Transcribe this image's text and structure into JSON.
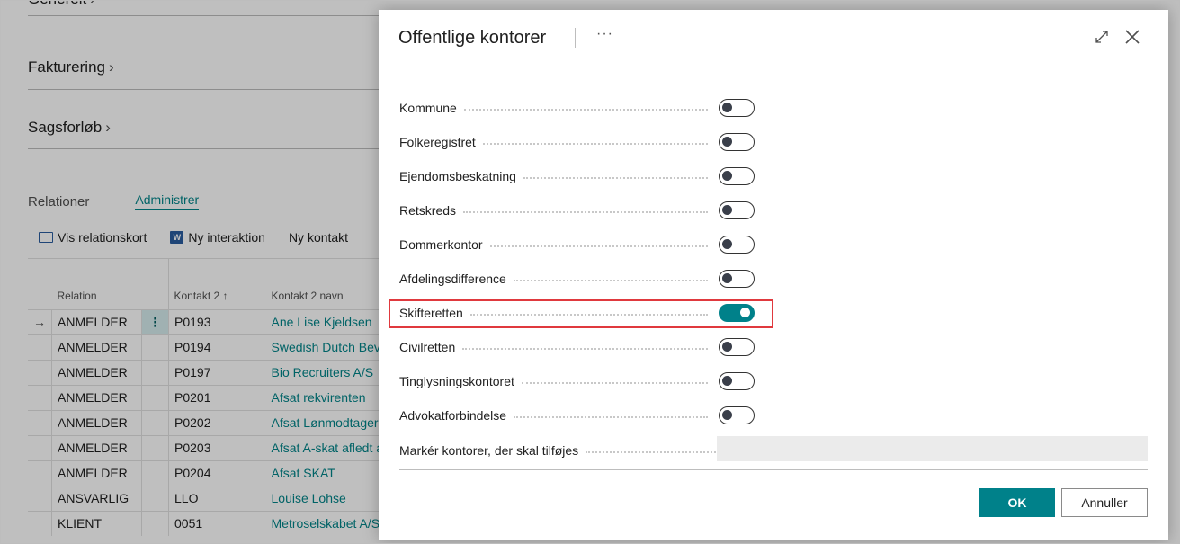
{
  "background": {
    "sections": {
      "generelt": "Generelt",
      "fakturering": "Fakturering",
      "sagsforloeb": "Sagsforløb"
    },
    "relations": {
      "title": "Relationer",
      "manage_tab": "Administrer",
      "actions": [
        "Vis relationskort",
        "Ny interaktion",
        "Ny kontakt"
      ],
      "columns": {
        "relation": "Relation",
        "kontakt2": "Kontakt 2 ↑",
        "kontakt2_navn": "Kontakt 2 navn"
      },
      "rows": [
        {
          "relation": "ANMELDER",
          "kontakt2": "P0193",
          "navn": "Ane Lise Kjeldsen"
        },
        {
          "relation": "ANMELDER",
          "kontakt2": "P0194",
          "navn": "Swedish Dutch Beve"
        },
        {
          "relation": "ANMELDER",
          "kontakt2": "P0197",
          "navn": "Bio Recruiters A/S"
        },
        {
          "relation": "ANMELDER",
          "kontakt2": "P0201",
          "navn": "Afsat rekvirenten"
        },
        {
          "relation": "ANMELDER",
          "kontakt2": "P0202",
          "navn": "Afsat Lønmodtagerr"
        },
        {
          "relation": "ANMELDER",
          "kontakt2": "P0203",
          "navn": "Afsat A-skat afledt a"
        },
        {
          "relation": "ANMELDER",
          "kontakt2": "P0204",
          "navn": "Afsat SKAT"
        },
        {
          "relation": "ANSVARLIG",
          "kontakt2": "LLO",
          "navn": "Louise Lohse"
        },
        {
          "relation": "KLIENT",
          "kontakt2": "0051",
          "navn": "Metroselskabet A/S"
        }
      ]
    }
  },
  "dialog": {
    "title": "Offentlige kontorer",
    "more_label": "···",
    "fields": [
      {
        "label": "Kommune",
        "on": false
      },
      {
        "label": "Folkeregistret",
        "on": false
      },
      {
        "label": "Ejendomsbeskatning",
        "on": false
      },
      {
        "label": "Retskreds",
        "on": false
      },
      {
        "label": "Dommerkontor",
        "on": false
      },
      {
        "label": "Afdelingsdifference",
        "on": false
      },
      {
        "label": "Skifteretten",
        "on": true
      },
      {
        "label": "Civilretten",
        "on": false
      },
      {
        "label": "Tinglysningskontoret",
        "on": false
      },
      {
        "label": "Advokatforbindelse",
        "on": false
      }
    ],
    "mark_label": "Markér kontorer, der skal tilføjes",
    "mark_value": "",
    "ok_label": "OK",
    "cancel_label": "Annuller"
  },
  "colors": {
    "accent": "#00818a",
    "highlight": "#e0393e"
  }
}
